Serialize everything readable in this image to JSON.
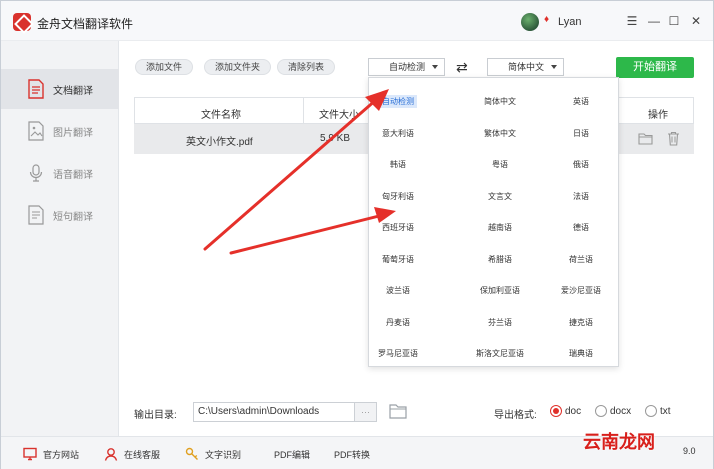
{
  "window": {
    "title": "金舟文档翻译软件",
    "user_name": "Lyan",
    "controls": {
      "menu": "☰",
      "minimize": "—",
      "maximize": "☐",
      "close": "✕"
    }
  },
  "sidebar": {
    "items": [
      {
        "label": "文档翻译",
        "icon": "document-icon",
        "active": true
      },
      {
        "label": "图片翻译",
        "icon": "image-icon",
        "active": false
      },
      {
        "label": "语音翻译",
        "icon": "microphone-icon",
        "active": false
      },
      {
        "label": "短句翻译",
        "icon": "text-icon",
        "active": false
      }
    ]
  },
  "toolbar": {
    "add_file": "添加文件",
    "add_folder": "添加文件夹",
    "clear_list": "清除列表",
    "source_lang": "自动检测",
    "target_lang": "简体中文",
    "swap_icon": "⇄",
    "start": "开始翻译"
  },
  "table": {
    "headers": {
      "name": "文件名称",
      "size": "文件大小",
      "op": "操作"
    },
    "rows": [
      {
        "name": "英文小作文.pdf",
        "size": "5.9 KB"
      }
    ]
  },
  "language_dropdown": {
    "options": [
      "自动检测",
      "简体中文",
      "英语",
      "意大利语",
      "繁体中文",
      "日语",
      "韩语",
      "粤语",
      "俄语",
      "匈牙利语",
      "文言文",
      "法语",
      "西班牙语",
      "越南语",
      "德语",
      "葡萄牙语",
      "希腊语",
      "荷兰语",
      "波兰语",
      "保加利亚语",
      "爱沙尼亚语",
      "丹麦语",
      "芬兰语",
      "捷克语",
      "罗马尼亚语",
      "斯洛文尼亚语",
      "瑞典语"
    ],
    "selected": "自动检测"
  },
  "output": {
    "label": "输出目录:",
    "path": "C:\\Users\\admin\\Downloads",
    "more": "···",
    "format_label": "导出格式:",
    "formats": [
      "doc",
      "docx",
      "txt"
    ],
    "selected_format": "doc"
  },
  "footer": {
    "items": [
      "官方网站",
      "在线客服",
      "文字识别",
      "PDF编辑",
      "PDF转换"
    ],
    "version": "9.0"
  },
  "watermark": "云南龙网",
  "colors": {
    "accent_green": "#2db84a",
    "brand_red": "#d9322d",
    "selected_blue": "#2a6fd6",
    "annotation_arrow": "#e5302a"
  }
}
